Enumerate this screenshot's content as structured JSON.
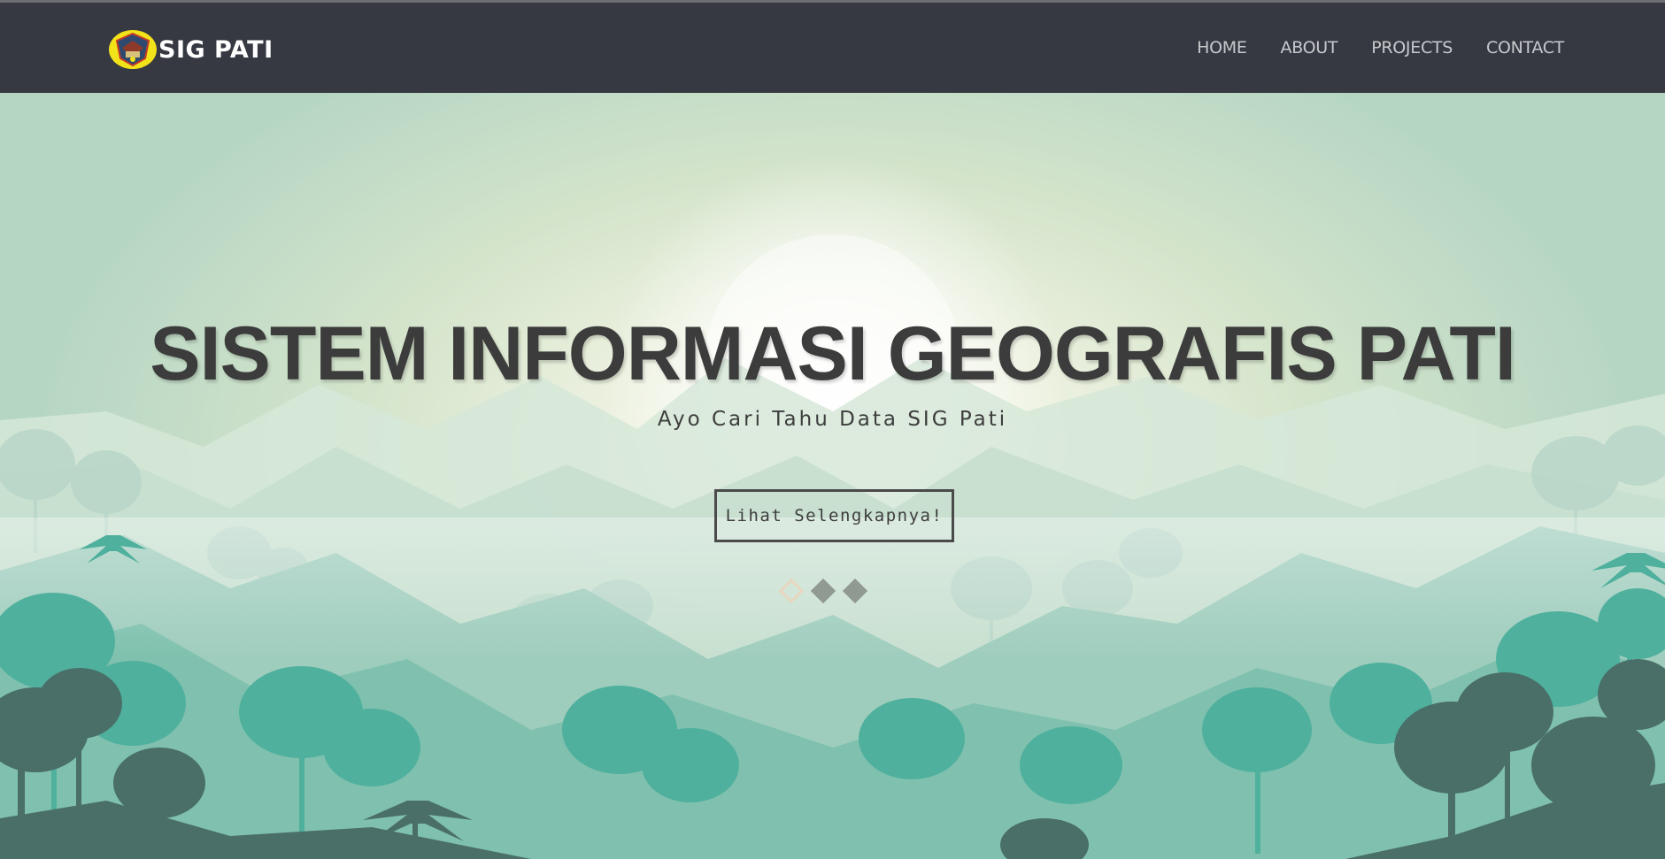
{
  "brand": {
    "logo_icon": "pati-regency-emblem-icon",
    "name": "SIG PATI"
  },
  "nav": {
    "items": [
      {
        "label": "HOME"
      },
      {
        "label": "ABOUT"
      },
      {
        "label": "PROJECTS"
      },
      {
        "label": "CONTACT"
      }
    ]
  },
  "hero": {
    "title": "SISTEM INFORMASI GEOGRAFIS PATI",
    "subtitle": "Ayo Cari Tahu Data SIG Pati",
    "cta_label": "Lihat Selengkapnya!",
    "slides": {
      "count": 3,
      "active_index": 0
    },
    "background": "misty-mountain-forest-illustration"
  },
  "colors": {
    "navbar": "#363942",
    "accent_logo": "#f2e21a",
    "title_text": "#3c3c3c",
    "forest_teal": "#4fb09d",
    "forest_dark": "#4a6e68"
  }
}
